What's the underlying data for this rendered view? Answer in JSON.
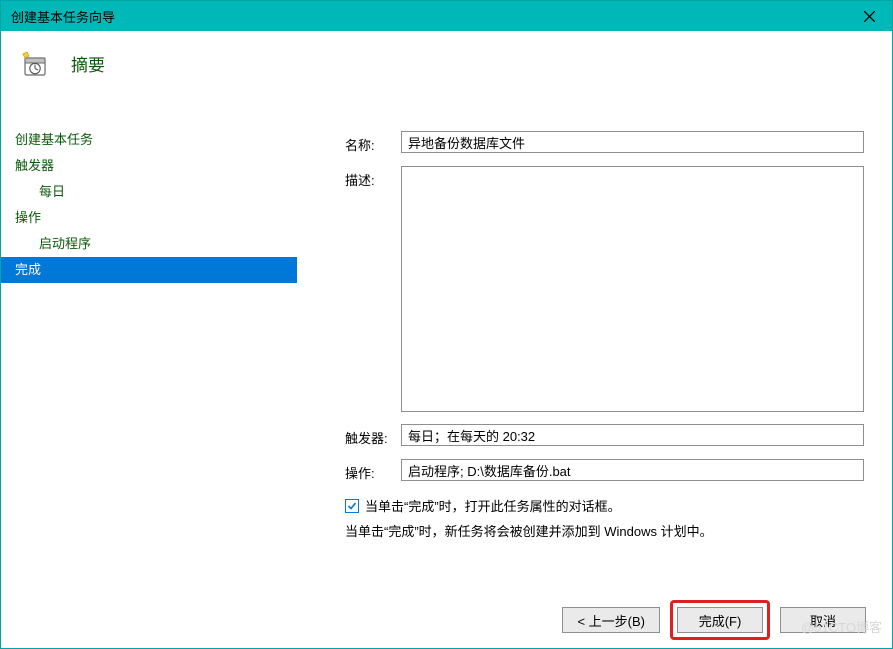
{
  "titlebar": {
    "title": "创建基本任务向导"
  },
  "header": {
    "title": "摘要"
  },
  "sidebar": {
    "items": [
      {
        "label": "创建基本任务",
        "sub": false,
        "active": false
      },
      {
        "label": "触发器",
        "sub": false,
        "active": false
      },
      {
        "label": "每日",
        "sub": true,
        "active": false
      },
      {
        "label": "操作",
        "sub": false,
        "active": false
      },
      {
        "label": "启动程序",
        "sub": true,
        "active": false
      },
      {
        "label": "完成",
        "sub": false,
        "active": true
      }
    ]
  },
  "form": {
    "name_label": "名称:",
    "name_value": "异地备份数据库文件",
    "desc_label": "描述:",
    "desc_value": "",
    "trigger_label": "触发器:",
    "trigger_value": "每日；在每天的 20:32",
    "action_label": "操作:",
    "action_value": "启动程序; D:\\数据库备份.bat"
  },
  "checkbox": {
    "checked": true,
    "label": "当单击“完成”时，打开此任务属性的对话框。"
  },
  "info_text": "当单击“完成”时，新任务将会被创建并添加到 Windows 计划中。",
  "buttons": {
    "back": "< 上一步(B)",
    "finish": "完成(F)",
    "cancel": "取消"
  },
  "watermark": "@51CTO博客"
}
